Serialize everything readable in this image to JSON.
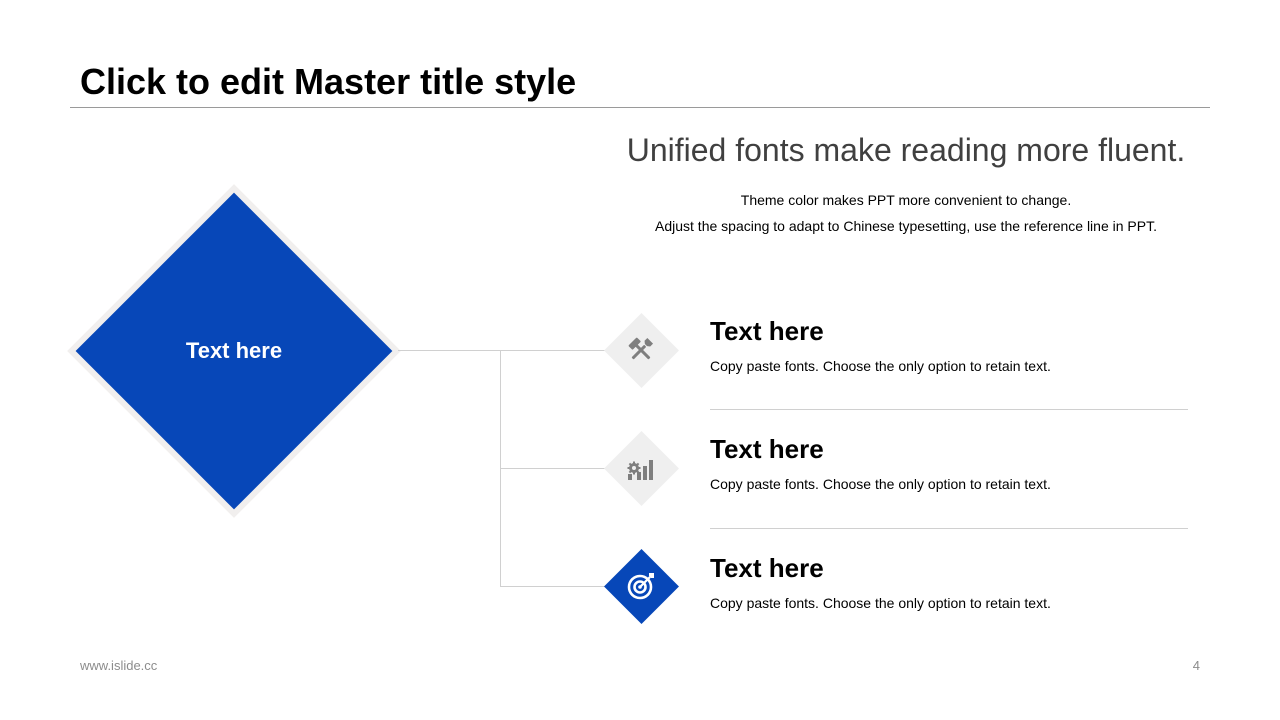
{
  "slide": {
    "title": "Click to edit Master title style",
    "headline": "Unified fonts make reading more fluent.",
    "subtitle_lines": [
      "Theme color makes PPT more convenient  to change.",
      "Adjust  the  spacing  to adapt  to Chinese  typesetting,  use  the  reference  line  in  PPT."
    ]
  },
  "main_diamond": {
    "label": "Text here",
    "color": "#0747b8"
  },
  "items": [
    {
      "title": "Text here",
      "description": "Copy paste fonts. Choose the only option to retain text.",
      "icon": "tools-icon",
      "active": false
    },
    {
      "title": "Text here",
      "description": "Copy paste fonts. Choose the only option to retain text.",
      "icon": "gear-chart-icon",
      "active": false
    },
    {
      "title": "Text here",
      "description": "Copy paste fonts. Choose the only option to retain text.",
      "icon": "target-icon",
      "active": true
    }
  ],
  "footer": {
    "website": "www.islide.cc",
    "page_number": "4"
  },
  "colors": {
    "accent": "#0747b8",
    "inactive_diamond": "#efefef",
    "icon_gray": "#7f7f7f"
  }
}
